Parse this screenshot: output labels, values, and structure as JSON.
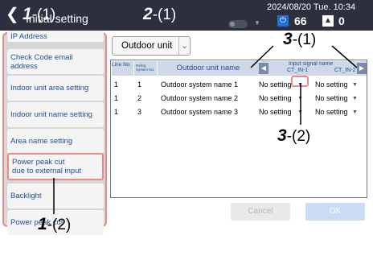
{
  "header": {
    "title": "Initial setting",
    "datetime": "2024/08/20 Tue. 10:34",
    "count": "66",
    "alert_count": "0"
  },
  "sidebar": {
    "items": [
      {
        "label": "IP Address"
      },
      {
        "label": "Check Code email address"
      },
      {
        "label": "Indoor unit area setting"
      },
      {
        "label": "Indoor unit name setting"
      },
      {
        "label": "Area name setting"
      },
      {
        "label": "Power peak cut\ndue to external input"
      },
      {
        "label": "Backlight"
      },
      {
        "label": "Power peak cut"
      }
    ]
  },
  "dropdown": {
    "value": "Outdoor unit"
  },
  "table": {
    "headers": {
      "line_no": "Line No.",
      "refrig_no": "Refrig. System No.",
      "name": "Outdoor unit name",
      "input_signal": "Input signal name",
      "ct1": "CT_IN-1",
      "ct2": "CT_IN-2"
    },
    "rows": [
      {
        "line": "1",
        "sys": "1",
        "name": "Outdoor system name 1",
        "ct1": "No setting",
        "ct2": "No setting"
      },
      {
        "line": "1",
        "sys": "2",
        "name": "Outdoor system name 2",
        "ct1": "No setting",
        "ct2": "No setting"
      },
      {
        "line": "1",
        "sys": "3",
        "name": "Outdoor system name 3",
        "ct1": "No setting",
        "ct2": "No setting"
      }
    ]
  },
  "buttons": {
    "cancel": "Cancel",
    "ok": "OK"
  },
  "annotations": {
    "a1_num": "1",
    "a1_sub": "-(1)",
    "a2_num": "2",
    "a2_sub": "-(1)",
    "a3_num": "3",
    "a3_sub": "-(1)",
    "a4_num": "3",
    "a4_sub": "-(2)",
    "a5_num": "1",
    "a5_sub": "-(2)"
  },
  "colors": {
    "header_bg": "#2b2f3e",
    "accent": "#1f6fd6",
    "highlight": "#e98a8a",
    "link_text": "#1f4f8f"
  },
  "icons": [
    "back-icon",
    "toggle-icon",
    "power-icon",
    "warning-icon",
    "chevron-down-icon",
    "arrow-left-icon",
    "arrow-right-icon"
  ]
}
